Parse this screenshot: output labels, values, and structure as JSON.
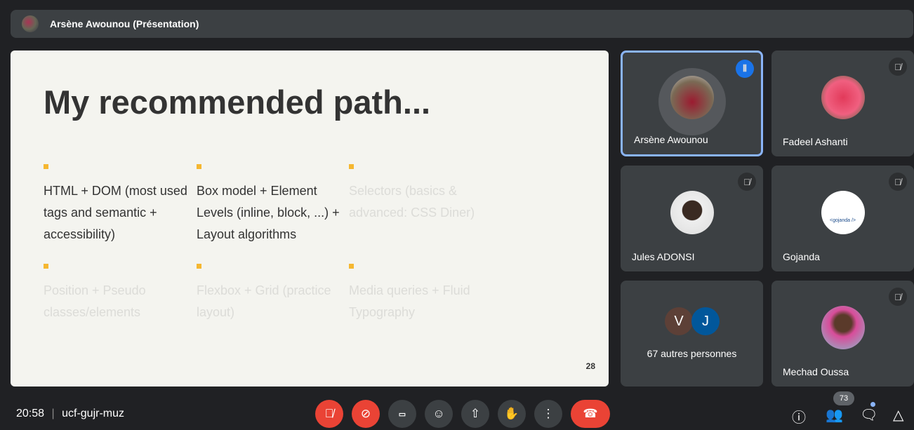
{
  "presenter_bar": {
    "title": "Arsène Awounou (Présentation)"
  },
  "slide": {
    "title": "My recommended path...",
    "page": "28",
    "items": [
      {
        "text": "HTML + DOM (most used tags and semantic + accessibility)"
      },
      {
        "text": "Box model + Element Levels (inline, block, ...) + Layout algorithms"
      },
      {
        "text": "Selectors (basics & advanced: CSS Diner)"
      },
      {
        "text": "Position + Pseudo classes/elements"
      },
      {
        "text": "Flexbox + Grid (practice layout)"
      },
      {
        "text": "Media queries + Fluid Typography"
      }
    ]
  },
  "participants": [
    {
      "name": "Arsène Awounou"
    },
    {
      "name": "Fadeel Ashanti"
    },
    {
      "name": "Jules ADONSI"
    },
    {
      "name": "Gojanda",
      "logo_text": "<gojanda />"
    },
    {
      "name": "67 autres personnes",
      "initials": [
        "V",
        "J"
      ]
    },
    {
      "name": "Mechad Oussa"
    }
  ],
  "footer": {
    "time": "20:58",
    "separator": "|",
    "meeting_code": "ucf-gujr-muz",
    "participant_count": "73"
  }
}
